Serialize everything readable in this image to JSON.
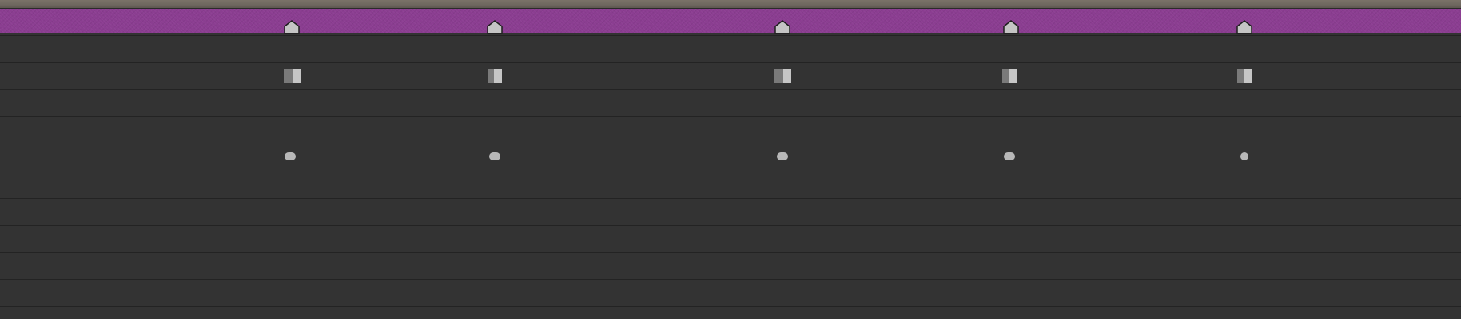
{
  "timeline": {
    "layer_bar": {
      "label": "",
      "color": "#8b3d91"
    },
    "track_row_count": 11,
    "markers": [
      {
        "name": "layer-marker-1",
        "icon": "pentagon-marker-icon"
      },
      {
        "name": "layer-marker-2",
        "icon": "pentagon-marker-icon"
      },
      {
        "name": "layer-marker-3",
        "icon": "pentagon-marker-icon"
      },
      {
        "name": "layer-marker-4",
        "icon": "pentagon-marker-icon"
      },
      {
        "name": "layer-marker-5",
        "icon": "pentagon-marker-icon"
      }
    ],
    "keyframes_hold": [
      {
        "name": "hold-keyframe-1",
        "icon": "hold-keyframe-icon"
      },
      {
        "name": "hold-keyframe-2",
        "icon": "hold-keyframe-icon"
      },
      {
        "name": "hold-keyframe-3",
        "icon": "hold-keyframe-icon"
      },
      {
        "name": "hold-keyframe-4",
        "icon": "hold-keyframe-icon"
      },
      {
        "name": "hold-keyframe-5",
        "icon": "hold-keyframe-icon"
      }
    ],
    "keyframes_roving": [
      {
        "name": "auto-bezier-keyframe-1",
        "icon": "auto-bezier-keyframe-icon"
      },
      {
        "name": "auto-bezier-keyframe-2",
        "icon": "auto-bezier-keyframe-icon"
      },
      {
        "name": "auto-bezier-keyframe-3",
        "icon": "auto-bezier-keyframe-icon"
      },
      {
        "name": "auto-bezier-keyframe-4",
        "icon": "auto-bezier-keyframe-icon"
      },
      {
        "name": "auto-bezier-keyframe-5",
        "icon": "auto-bezier-keyframe-icon"
      }
    ]
  }
}
